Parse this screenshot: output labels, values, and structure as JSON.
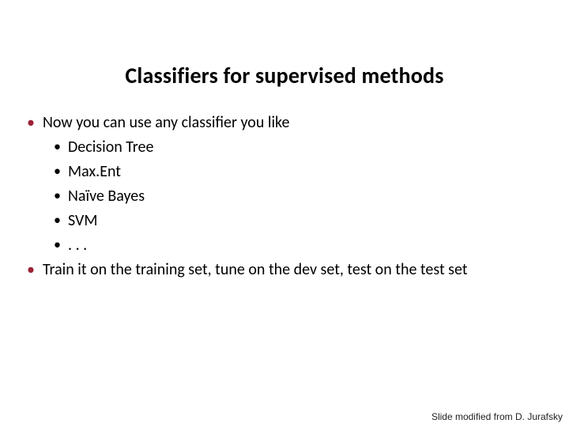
{
  "title": "Classifiers for supervised methods",
  "bullets": {
    "b1": "Now you can use any classifier you like",
    "b1_sub": {
      "s1": "Decision Tree",
      "s2": "Max.Ent",
      "s3": "Naïve Bayes",
      "s4": "SVM",
      "s5": ". . ."
    },
    "b2": "Train it on the training set, tune on the dev set, test on the test set"
  },
  "credit": "Slide modified from D. Jurafsky"
}
